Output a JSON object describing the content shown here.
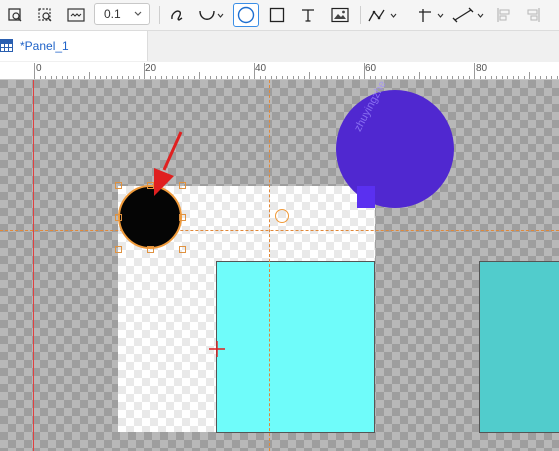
{
  "toolbar": {
    "zoom_value": "0.1",
    "tools": [
      {
        "name": "zoom-area-icon"
      },
      {
        "name": "zoom-selection-icon"
      },
      {
        "name": "fit-width-icon"
      },
      {
        "name": "freehand-pen-icon"
      },
      {
        "name": "arc-icon"
      },
      {
        "name": "ellipse-icon",
        "active": true
      },
      {
        "name": "rectangle-icon"
      },
      {
        "name": "text-icon"
      },
      {
        "name": "image-icon"
      },
      {
        "name": "polyline-icon"
      },
      {
        "name": "guide-line-icon"
      },
      {
        "name": "measure-icon"
      },
      {
        "name": "align-left-icon"
      },
      {
        "name": "align-right-icon"
      }
    ]
  },
  "tabs": [
    {
      "label": "Panel_1",
      "modified_marker": "*"
    }
  ],
  "ruler": {
    "labels": [
      "0",
      "20",
      "40",
      "60",
      "80"
    ]
  },
  "canvas": {
    "watermark_text": "zhuyingzhe",
    "colors": {
      "purple_circle": "#5028d0",
      "cyan_rect": "#6ffcfa",
      "teal_rect": "#51cccc",
      "black_circle": "#050505",
      "selection_handles": "#e09240",
      "red_guide": "#e04040",
      "arrow": "#e02020"
    }
  }
}
